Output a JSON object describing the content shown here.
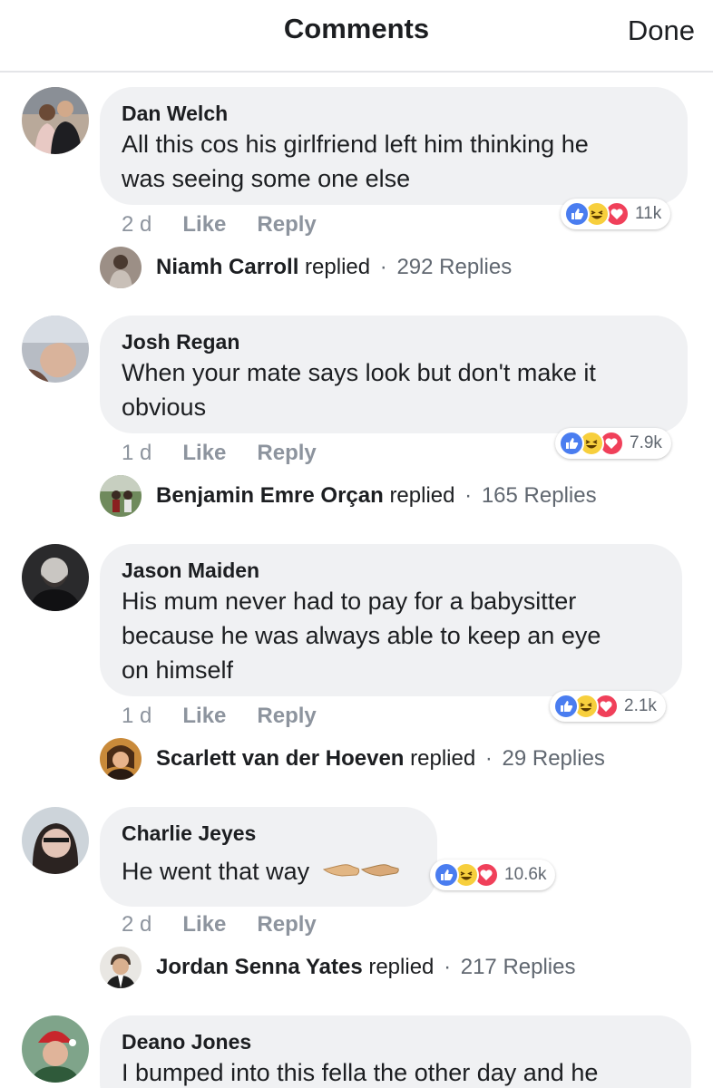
{
  "header": {
    "title": "Comments",
    "done_label": "Done"
  },
  "comments": [
    {
      "author": "Dan Welch",
      "lines": [
        "All this cos his girlfriend left him thinking he",
        "was seeing some one else"
      ],
      "time": "2 d",
      "like_label": "Like",
      "reply_label": "Reply",
      "reactions_count": "11k",
      "reply": {
        "name": "Niamh Carroll",
        "verb": "replied",
        "dot": "·",
        "count": "292 Replies"
      }
    },
    {
      "author": "Josh Regan",
      "lines": [
        "When your mate says look but don't make it",
        "obvious"
      ],
      "time": "1 d",
      "like_label": "Like",
      "reply_label": "Reply",
      "reactions_count": "7.9k",
      "reply": {
        "name": "Benjamin Emre Orçan",
        "verb": "replied",
        "dot": "·",
        "count": "165 Replies"
      }
    },
    {
      "author": "Jason Maiden",
      "lines": [
        "His mum never had to pay for a babysitter",
        "because he was always able to keep an eye",
        "on himself"
      ],
      "time": "1 d",
      "like_label": "Like",
      "reply_label": "Reply",
      "reactions_count": "2.1k",
      "reply": {
        "name": "Scarlett van der Hoeven",
        "verb": "replied",
        "dot": "·",
        "count": "29 Replies"
      }
    },
    {
      "author": "Charlie Jeyes",
      "lines": [
        "He went that way"
      ],
      "emoji": "pointing-hands-emoji",
      "time": "2 d",
      "like_label": "Like",
      "reply_label": "Reply",
      "reactions_count": "10.6k",
      "reply": {
        "name": "Jordan Senna Yates",
        "verb": "replied",
        "dot": "·",
        "count": "217 Replies"
      }
    },
    {
      "author": "Deano Jones",
      "lines": [
        "I bumped into this fella the other day and he"
      ]
    }
  ],
  "icons": {
    "like": "thumbs-up-icon",
    "haha": "laughing-face-icon",
    "love": "heart-icon"
  },
  "colors": {
    "like": "#4a7df0",
    "haha": "#f7cf3d",
    "love": "#f0405a",
    "bubble": "#f0f1f3",
    "meta": "#8d949e"
  }
}
